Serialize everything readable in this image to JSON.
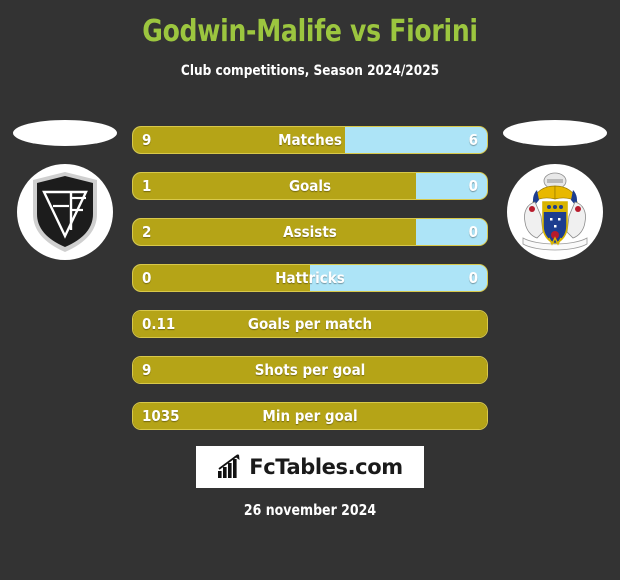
{
  "header": {
    "title": "Godwin-Malife vs Fiorini",
    "subtitle": "Club competitions, Season 2024/2025",
    "title_color": "#9cc63f"
  },
  "theme": {
    "background": "#333333",
    "home_color": "#b5a417",
    "away_color": "#ade4f7",
    "bar_border": "#d8c84a",
    "text_color": "#ffffff"
  },
  "teams": {
    "home": {
      "crest_name": "home-team-crest"
    },
    "away": {
      "crest_name": "away-team-crest",
      "banner_text": "NEWPORT COUNTY"
    }
  },
  "chart_data": {
    "type": "bar",
    "title": "Godwin-Malife vs Fiorini",
    "subtitle": "Club competitions, Season 2024/2025",
    "orientation": "horizontal",
    "legend": [
      "Godwin-Malife",
      "Fiorini"
    ],
    "categories": [
      "Matches",
      "Goals",
      "Assists",
      "Hattricks",
      "Goals per match",
      "Shots per goal",
      "Min per goal"
    ],
    "series": [
      {
        "name": "Godwin-Malife",
        "values": [
          9,
          1,
          2,
          0,
          0.11,
          9,
          1035
        ]
      },
      {
        "name": "Fiorini",
        "values": [
          6,
          0,
          0,
          0,
          null,
          null,
          null
        ]
      }
    ],
    "rows": [
      {
        "label": "Matches",
        "home": "9",
        "away": "6",
        "home_pct": 60,
        "comparative": true
      },
      {
        "label": "Goals",
        "home": "1",
        "away": "0",
        "home_pct": 80,
        "comparative": true
      },
      {
        "label": "Assists",
        "home": "2",
        "away": "0",
        "home_pct": 80,
        "comparative": true
      },
      {
        "label": "Hattricks",
        "home": "0",
        "away": "0",
        "home_pct": 50,
        "comparative": true
      },
      {
        "label": "Goals per match",
        "home": "0.11",
        "away": "",
        "home_pct": 100,
        "comparative": false
      },
      {
        "label": "Shots per goal",
        "home": "9",
        "away": "",
        "home_pct": 100,
        "comparative": false
      },
      {
        "label": "Min per goal",
        "home": "1035",
        "away": "",
        "home_pct": 100,
        "comparative": false
      }
    ]
  },
  "footer": {
    "brand": "FcTables.com",
    "brand_icon": "bar-chart-arrow-icon",
    "date": "26 november 2024"
  }
}
